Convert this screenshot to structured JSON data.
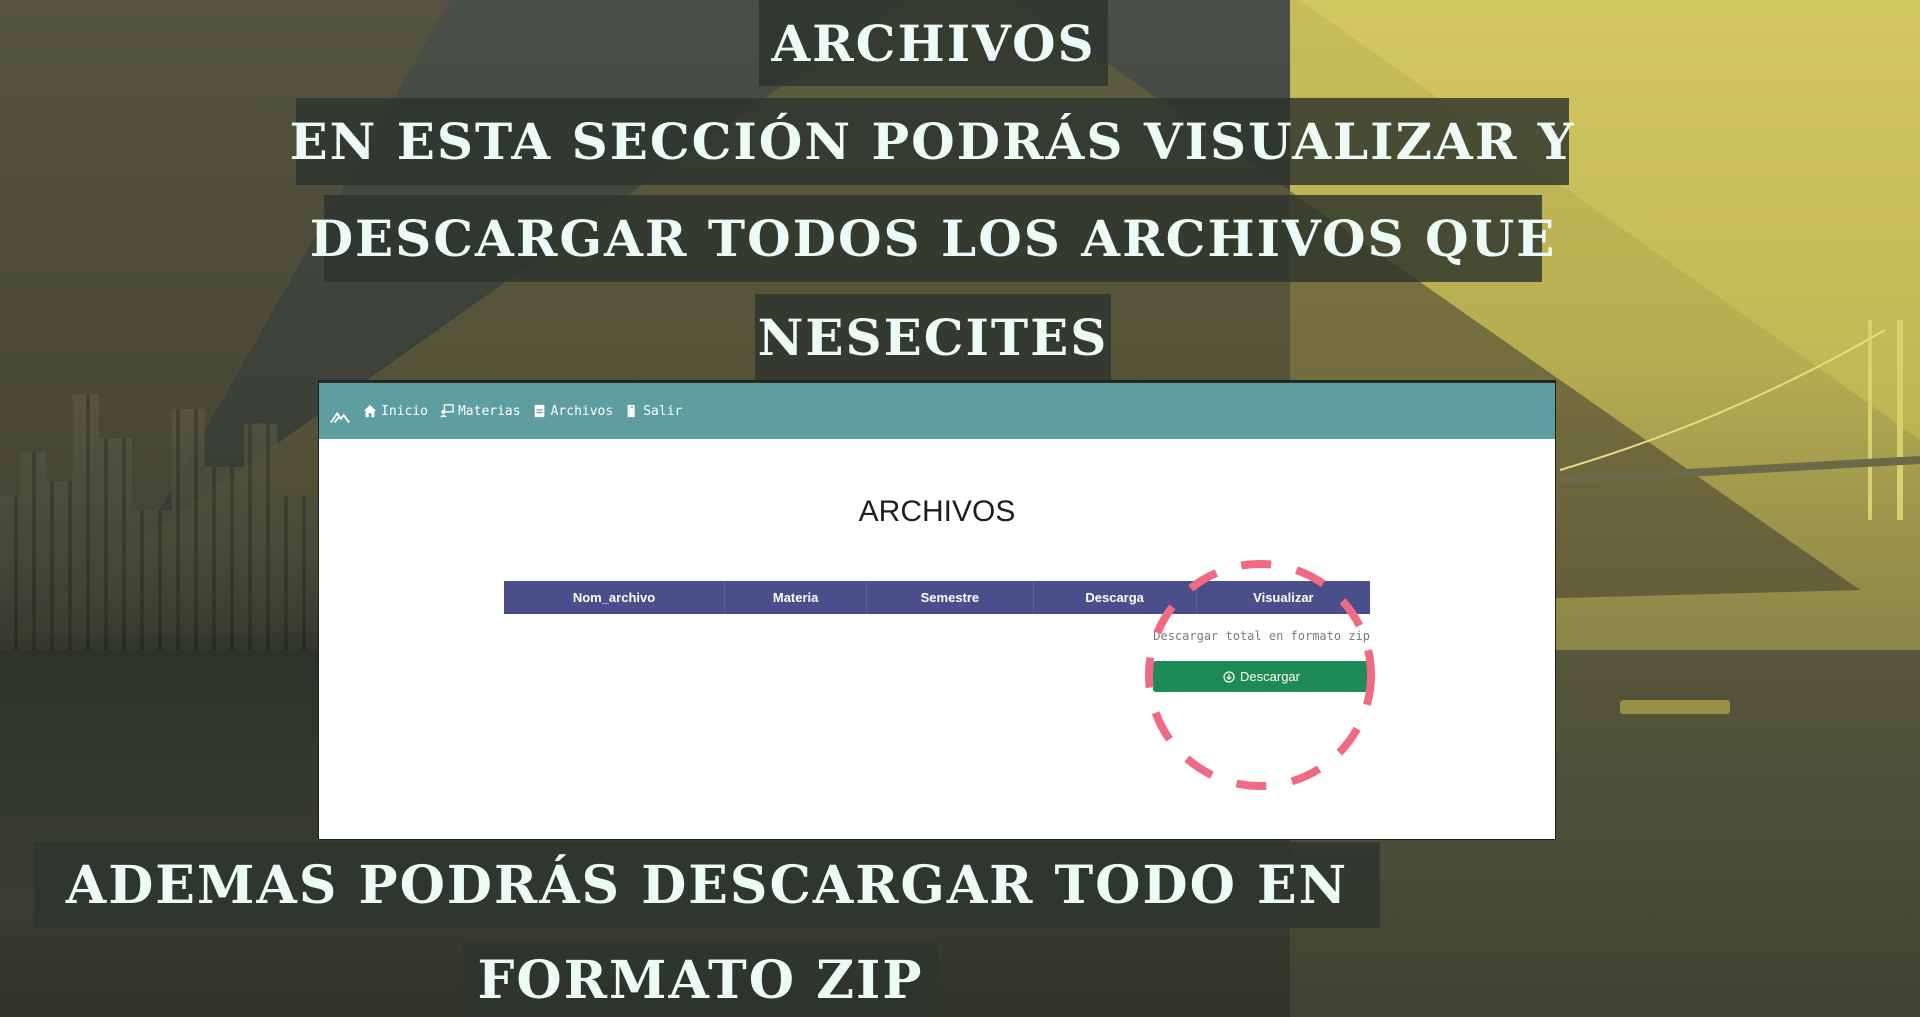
{
  "colors": {
    "caption_bg": "#2d342d",
    "caption_text": "#ecfbf6",
    "navbar_bg": "#5f9ea0",
    "table_header_bg": "#4a4e8a",
    "download_button_bg": "#1e8a55",
    "highlight_circle": "#f06a84"
  },
  "captions": {
    "title": "ARCHIVOS",
    "line1": "EN ESTA SECCIÓN PODRÁS VISUALIZAR Y",
    "line2": "DESCARGAR TODOS LOS ARCHIVOS QUE",
    "line3": "NESECITES",
    "bottom1": "ADEMAS PODRÁS DESCARGAR TODO EN",
    "bottom2": "FORMATO ZIP"
  },
  "app": {
    "navbar": {
      "logo_icon": "mountain-logo-icon",
      "items": [
        {
          "label": "Inicio",
          "icon": "home-icon"
        },
        {
          "label": "Materias",
          "icon": "user-board-icon"
        },
        {
          "label": "Archivos",
          "icon": "file-icon"
        },
        {
          "label": "Salir",
          "icon": "door-exit-icon"
        }
      ]
    },
    "heading": "ARCHIVOS",
    "table": {
      "columns": [
        "Nom_archivo",
        "Materia",
        "Semestre",
        "Descarga",
        "Visualizar"
      ]
    },
    "zip_note": "Descargar total en formato zip",
    "download_button": {
      "label": "Descargar",
      "icon": "circle-arrow-down-icon"
    }
  }
}
